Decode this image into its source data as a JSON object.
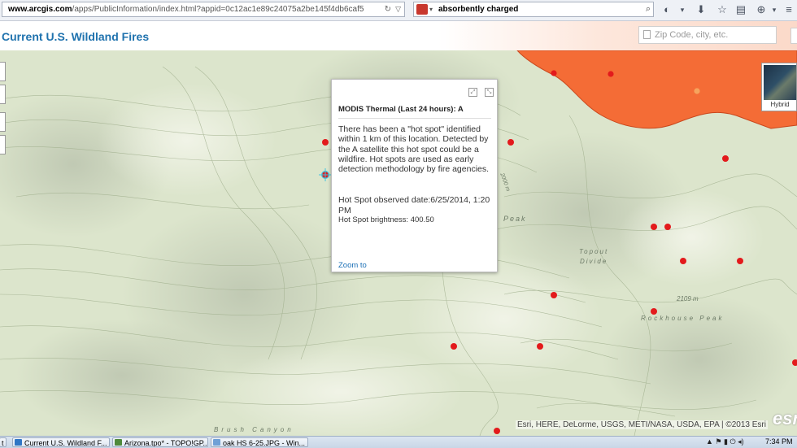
{
  "browser": {
    "url_host": "www.arcgis.com",
    "url_rest": "/apps/PublicInformation/index.html?appid=0c12ac1e89c24075a2be145f4db6caf5",
    "search_query": "absorbently charged"
  },
  "app": {
    "title": "Current U.S. Wildland Fires",
    "search_placeholder": "Zip Code, city, etc."
  },
  "map": {
    "labels": {
      "peak": "Peak",
      "topout_divide_1": "Topout",
      "topout_divide_2": "Divide",
      "elev_2109": "2109 m",
      "elev_2000": "2000 m",
      "rockhouse_peak": "Rockhouse Peak",
      "brush_canyon": "Brush Canyon"
    },
    "basemap_label": "Hybrid",
    "attribution": "Esri, HERE, DeLorme, USGS, METI/NASA, USDA, EPA | ©2013 Esri",
    "logo_text": "esri",
    "colors": {
      "fire_perimeter": "#f46c36",
      "hotspot": "#e31a1c",
      "terrain": "#dfe7cf"
    }
  },
  "popup": {
    "title": "MODIS Thermal (Last 24 hours): A",
    "description": "There has been a \"hot spot\" identified within 1 km of this location. Detected by the A satellite this hot spot could be a wildfire. Hot spots are used as early detection methodology by fire agencies.",
    "observed": "Hot Spot observed date:6/25/2014, 1:20 PM",
    "brightness": "Hot Spot brightness: 400.50",
    "zoom_link": "Zoom to"
  },
  "taskbar": {
    "items": [
      "t",
      "Current U.S. Wildland F...",
      "Arizona.tpo* - TOPO!GP...",
      "oak HS 6-25.JPG - Win..."
    ],
    "clock": "7:34 PM"
  }
}
